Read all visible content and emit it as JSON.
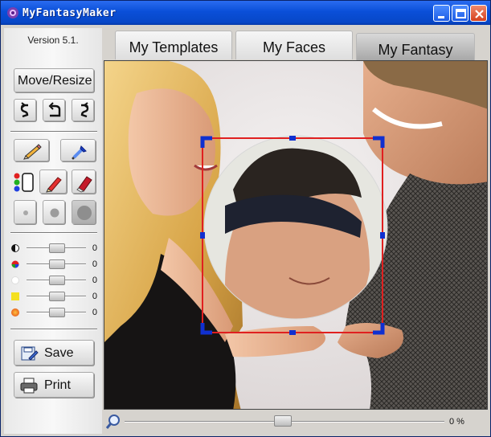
{
  "window": {
    "title": "MyFantasyMaker"
  },
  "sidebar": {
    "version": "Version 5.1.",
    "move_resize_label": "Move/Resize",
    "sliders": [
      {
        "name": "brightness",
        "value": "0",
        "level": 0
      },
      {
        "name": "color",
        "value": "0",
        "level": 0
      },
      {
        "name": "white",
        "value": "0",
        "level": 0
      },
      {
        "name": "yellow",
        "value": "0",
        "level": 0
      },
      {
        "name": "red",
        "value": "0",
        "level": 0
      }
    ],
    "save_label": "Save",
    "print_label": "Print"
  },
  "tabs": [
    {
      "label": "My Templates",
      "active": false
    },
    {
      "label": "My Faces",
      "active": false
    },
    {
      "label": "My Fantasy",
      "active": true
    }
  ],
  "zoom": {
    "value": "0 %",
    "level": 0.5
  },
  "colors": {
    "titlebar": "#0a4fd8",
    "selection_frame": "#e02020",
    "handles": "#1030d0"
  }
}
